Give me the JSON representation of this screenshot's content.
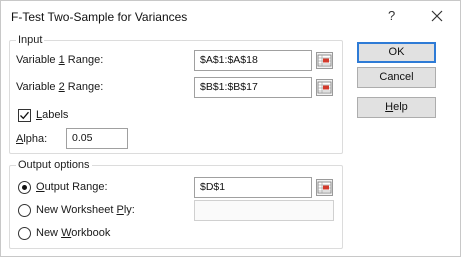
{
  "dialog": {
    "title": "F-Test Two-Sample for Variances",
    "help_glyph": "?",
    "close_glyph": "×"
  },
  "input_group": {
    "legend": "Input",
    "var1": {
      "label_pre": "Variable ",
      "label_key": "1",
      "label_post": " Range:",
      "value": "$A$1:$A$18"
    },
    "var2": {
      "label_pre": "Variable ",
      "label_key": "2",
      "label_post": " Range:",
      "value": "$B$1:$B$17"
    },
    "labels": {
      "label_key": "L",
      "label_post": "abels",
      "checked": true
    },
    "alpha": {
      "label_key": "A",
      "label_post": "lpha:",
      "value": "0.05"
    }
  },
  "output_group": {
    "legend": "Output options",
    "output_range": {
      "label_key": "O",
      "label_post": "utput Range:",
      "value": "$D$1",
      "selected": true
    },
    "new_ply": {
      "label_pre": "New Worksheet ",
      "label_key": "P",
      "label_post": "ly:",
      "value": ""
    },
    "new_workbook": {
      "label_pre": "New ",
      "label_key": "W",
      "label_post": "orkbook"
    }
  },
  "buttons": {
    "ok": "OK",
    "cancel": "Cancel",
    "help_key": "H",
    "help_post": "elp"
  },
  "colors": {
    "accent": "#2e7bd6",
    "ref_icon_red": "#d33a2c"
  }
}
